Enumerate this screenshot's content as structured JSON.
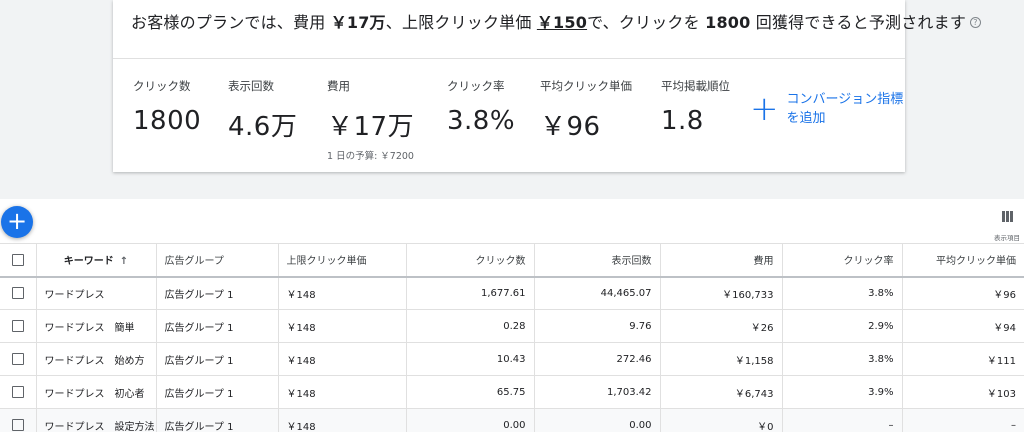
{
  "summary": {
    "headline": {
      "t1": "お客様のプランでは、費用 ",
      "cost": "￥17万",
      "t2": "、上限クリック単価 ",
      "max_cpc": "￥150",
      "t3": "で、クリックを ",
      "clicks": "1800",
      "t4": " 回獲得できると予測されます",
      "help_icon": "?"
    },
    "metrics": [
      {
        "label": "クリック数",
        "value": "1800"
      },
      {
        "label": "表示回数",
        "value": "4.6万"
      },
      {
        "label": "費用",
        "value": "￥17万",
        "sub": "1 日の予算: ￥7200"
      },
      {
        "label": "クリック率",
        "value": "3.8%"
      },
      {
        "label": "平均クリック単価",
        "value": "￥96"
      },
      {
        "label": "平均掲載順位",
        "value": "1.8"
      }
    ],
    "add_conversion": {
      "icon": "+",
      "label": "コンバージョン指標を追加"
    }
  },
  "toolbar": {
    "fab_icon": "+",
    "columns_label": "表示項目"
  },
  "table": {
    "headers": [
      "キーワード",
      "広告グループ",
      "上限クリック単価",
      "クリック数",
      "表示回数",
      "費用",
      "クリック率",
      "平均クリック単価"
    ],
    "sort_icon": "↑",
    "rows": [
      [
        "ワードプレス",
        "広告グループ 1",
        "￥148",
        "1,677.61",
        "44,465.07",
        "￥160,733",
        "3.8%",
        "￥96"
      ],
      [
        "ワードプレス　簡単",
        "広告グループ 1",
        "￥148",
        "0.28",
        "9.76",
        "￥26",
        "2.9%",
        "￥94"
      ],
      [
        "ワードプレス　始め方",
        "広告グループ 1",
        "￥148",
        "10.43",
        "272.46",
        "￥1,158",
        "3.8%",
        "￥111"
      ],
      [
        "ワードプレス　初心者",
        "広告グループ 1",
        "￥148",
        "65.75",
        "1,703.42",
        "￥6,743",
        "3.9%",
        "￥103"
      ],
      [
        "ワードプレス　設定方法",
        "広告グループ 1",
        "￥148",
        "0.00",
        "0.00",
        "￥0",
        "–",
        "–"
      ]
    ]
  }
}
